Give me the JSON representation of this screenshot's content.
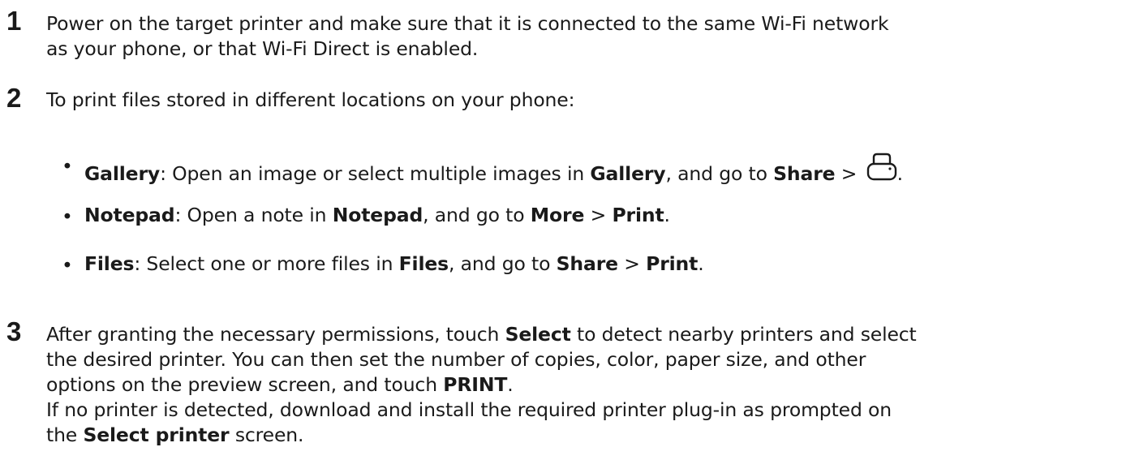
{
  "steps": [
    {
      "number": "1",
      "lines": [
        "Power on the target printer and make sure that it is connected to the same Wi-Fi network",
        "as your phone, or that Wi-Fi Direct is enabled."
      ]
    },
    {
      "number": "2",
      "intro": "To print files stored in different locations on your phone:",
      "bullets": [
        {
          "app": "Gallery",
          "t1": ": Open an image or select multiple images in ",
          "app2": "Gallery",
          "t2": ", and go to ",
          "menu1": "Share",
          "sep": " > ",
          "icon": "printer-icon",
          "end": "."
        },
        {
          "app": "Notepad",
          "t1": ": Open a note in ",
          "app2": "Notepad",
          "t2": ", and go to ",
          "menu1": "More",
          "sep": " > ",
          "menu2": "Print",
          "end": "."
        },
        {
          "app": "Files",
          "t1": ": Select one or more files in ",
          "app2": "Files",
          "t2": ", and go to ",
          "menu1": "Share",
          "sep": " > ",
          "menu2": "Print",
          "end": "."
        }
      ]
    },
    {
      "number": "3",
      "p1_a": "After granting the necessary permissions, touch ",
      "p1_select": "Select",
      "p1_b": " to detect nearby printers and select",
      "p1_line2": "the desired printer. You can then set the number of copies, color, paper size, and other",
      "p1_line3a": "options on the preview screen, and touch ",
      "p1_print": "PRINT",
      "p1_line3b": ".",
      "p2_line1": "If no printer is detected, download and install the required printer plug-in as prompted on",
      "p2_a": "the ",
      "p2_screen": "Select printer",
      "p2_b": " screen."
    }
  ]
}
